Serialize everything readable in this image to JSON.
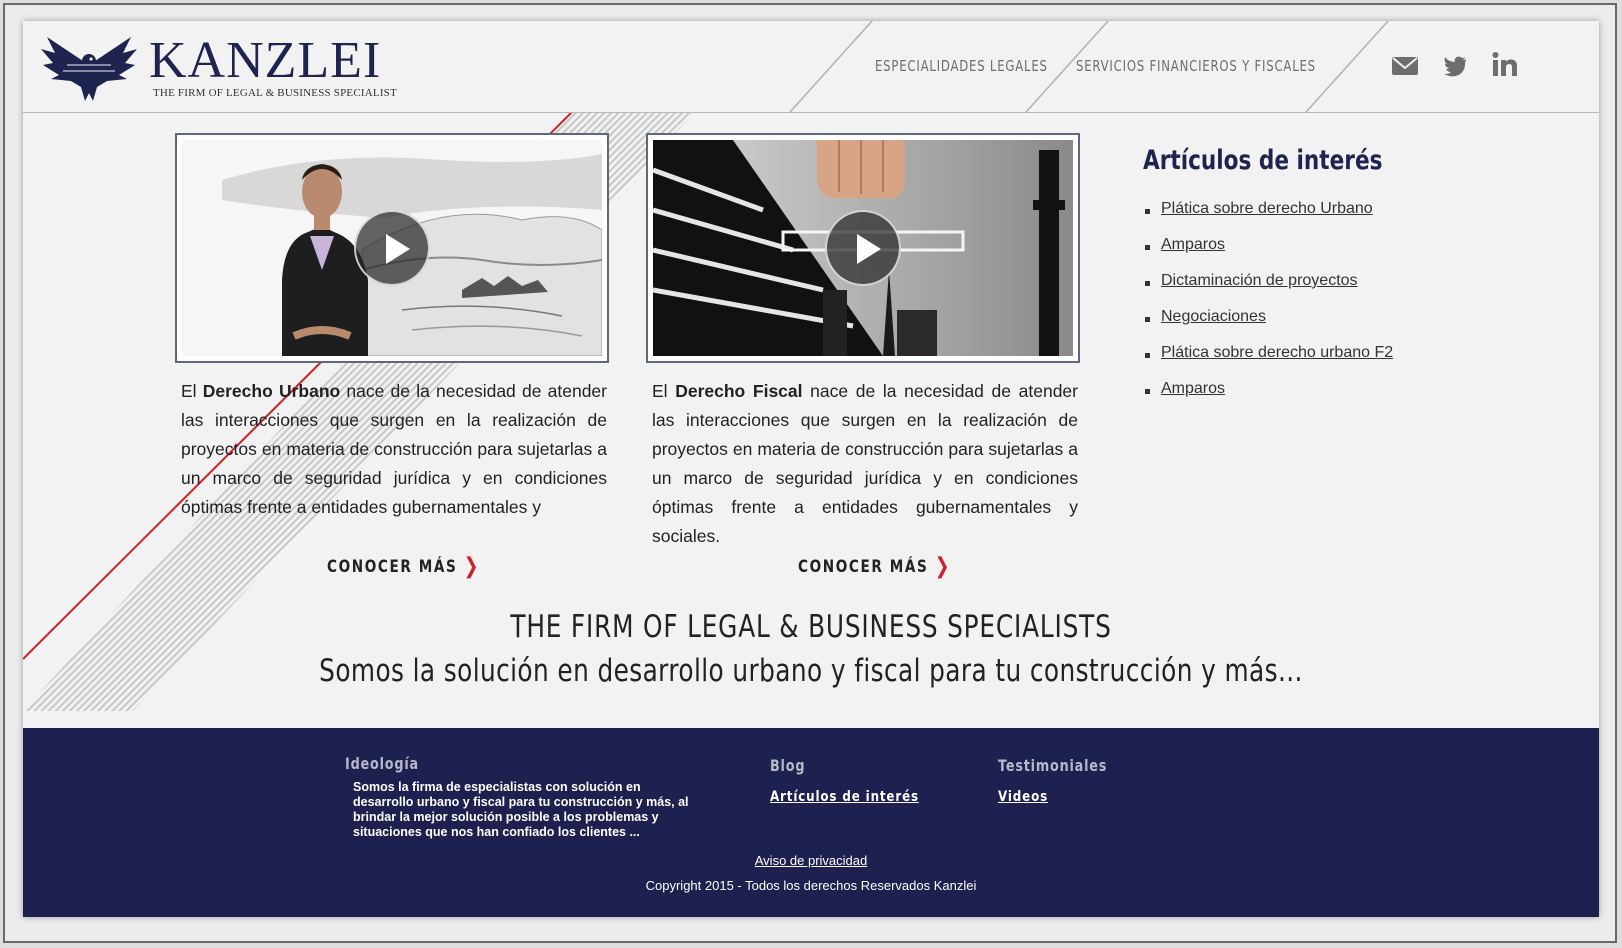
{
  "brand": {
    "name": "KANZLEI",
    "tagline": "THE FIRM OF LEGAL & BUSINESS SPECIALIST"
  },
  "nav": [
    {
      "label": "ESPECIALIDADES LEGALES"
    },
    {
      "label": "SERVICIOS FINANCIEROS Y FISCALES"
    }
  ],
  "social": [
    "mail-icon",
    "twitter-icon",
    "linkedin-icon"
  ],
  "cards": [
    {
      "lead": "El ",
      "bold": "Derecho Urbano",
      "text": " nace de la necesidad de atender las interacciones que surgen en la realización de proyectos en materia de construcción para sujetarlas a un marco de seguridad jurídica y en condiciones óptimas frente a entidades gubernamentales y",
      "more": "CONOCER MÁS"
    },
    {
      "lead": "El ",
      "bold": "Derecho Fiscal",
      "text": " nace de la necesidad de atender las interacciones que surgen en la realización de proyectos en materia de construcción para sujetarlas a un marco de seguridad jurídica y en condiciones óptimas frente a entidades gubernamentales y sociales.",
      "more": "CONOCER MÁS"
    }
  ],
  "articles": {
    "title": "Artículos de interés",
    "items": [
      "Plática sobre derecho Urbano",
      "Amparos",
      "Dictaminación de proyectos",
      "Negociaciones",
      "Plática sobre derecho urbano F2",
      "Amparos"
    ]
  },
  "tagline": {
    "line1": "THE FIRM OF LEGAL & BUSINESS SPECIALISTS",
    "line2": "Somos la solución en desarrollo urbano y fiscal para tu construcción y más..."
  },
  "footer": {
    "ideologia_title": "Ideología",
    "ideologia_text": "Somos la firma de especialistas con solución en desarrollo urbano y fiscal para tu construcción y más, al brindar la mejor solución posible a los problemas y situaciones que nos han confiado los clientes ...",
    "blog_title": "Blog",
    "blog_link": "Artículos de interés",
    "testimonios_title": "Testimoniales",
    "testimonios_link": "Videos",
    "privacy": "Aviso de privacidad",
    "copyright": "Copyright 2015 - Todos los derechos Reservados Kanzlei"
  },
  "colors": {
    "navy": "#1e2150",
    "accent_red": "#d0202a",
    "text_gray": "#6d6d6d"
  }
}
